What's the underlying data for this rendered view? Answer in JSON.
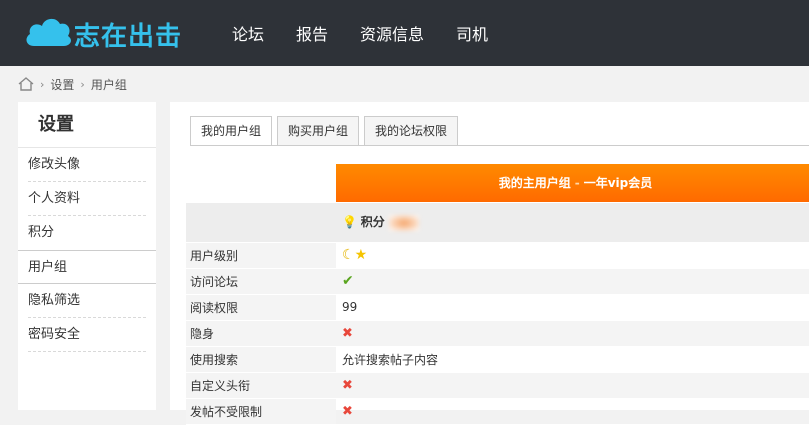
{
  "header": {
    "logo_text": "志在出击",
    "nav": [
      "论坛",
      "报告",
      "资源信息",
      "司机"
    ]
  },
  "breadcrumb": {
    "items": [
      "设置",
      "用户组"
    ]
  },
  "sidebar": {
    "title": "设置",
    "items": [
      {
        "label": "修改头像"
      },
      {
        "label": "个人资料"
      },
      {
        "label": "积分"
      },
      {
        "label": "用户组"
      },
      {
        "label": "隐私筛选"
      },
      {
        "label": "密码安全"
      }
    ],
    "active_index": 3
  },
  "tabs": [
    {
      "label": "我的用户组"
    },
    {
      "label": "购买用户组"
    },
    {
      "label": "我的论坛权限"
    }
  ],
  "group": {
    "header_prefix": "我的主用户组",
    "header_sep": "-",
    "header_name": "一年vip会员",
    "points_label": "积分"
  },
  "rows": [
    {
      "label": "用户级别",
      "type": "stars"
    },
    {
      "label": "访问论坛",
      "type": "yes"
    },
    {
      "label": "阅读权限",
      "type": "text",
      "value": "99"
    },
    {
      "label": "隐身",
      "type": "no"
    },
    {
      "label": "使用搜索",
      "type": "text",
      "value": "允许搜索帖子内容"
    },
    {
      "label": "自定义头衔",
      "type": "no"
    },
    {
      "label": "发帖不受限制",
      "type": "no"
    }
  ],
  "colors": {
    "topbar": "#2e3238",
    "logo": "#35c1ec",
    "accent_orange": "#ff7a00",
    "yes": "#5aa51f",
    "no": "#e8473b"
  }
}
